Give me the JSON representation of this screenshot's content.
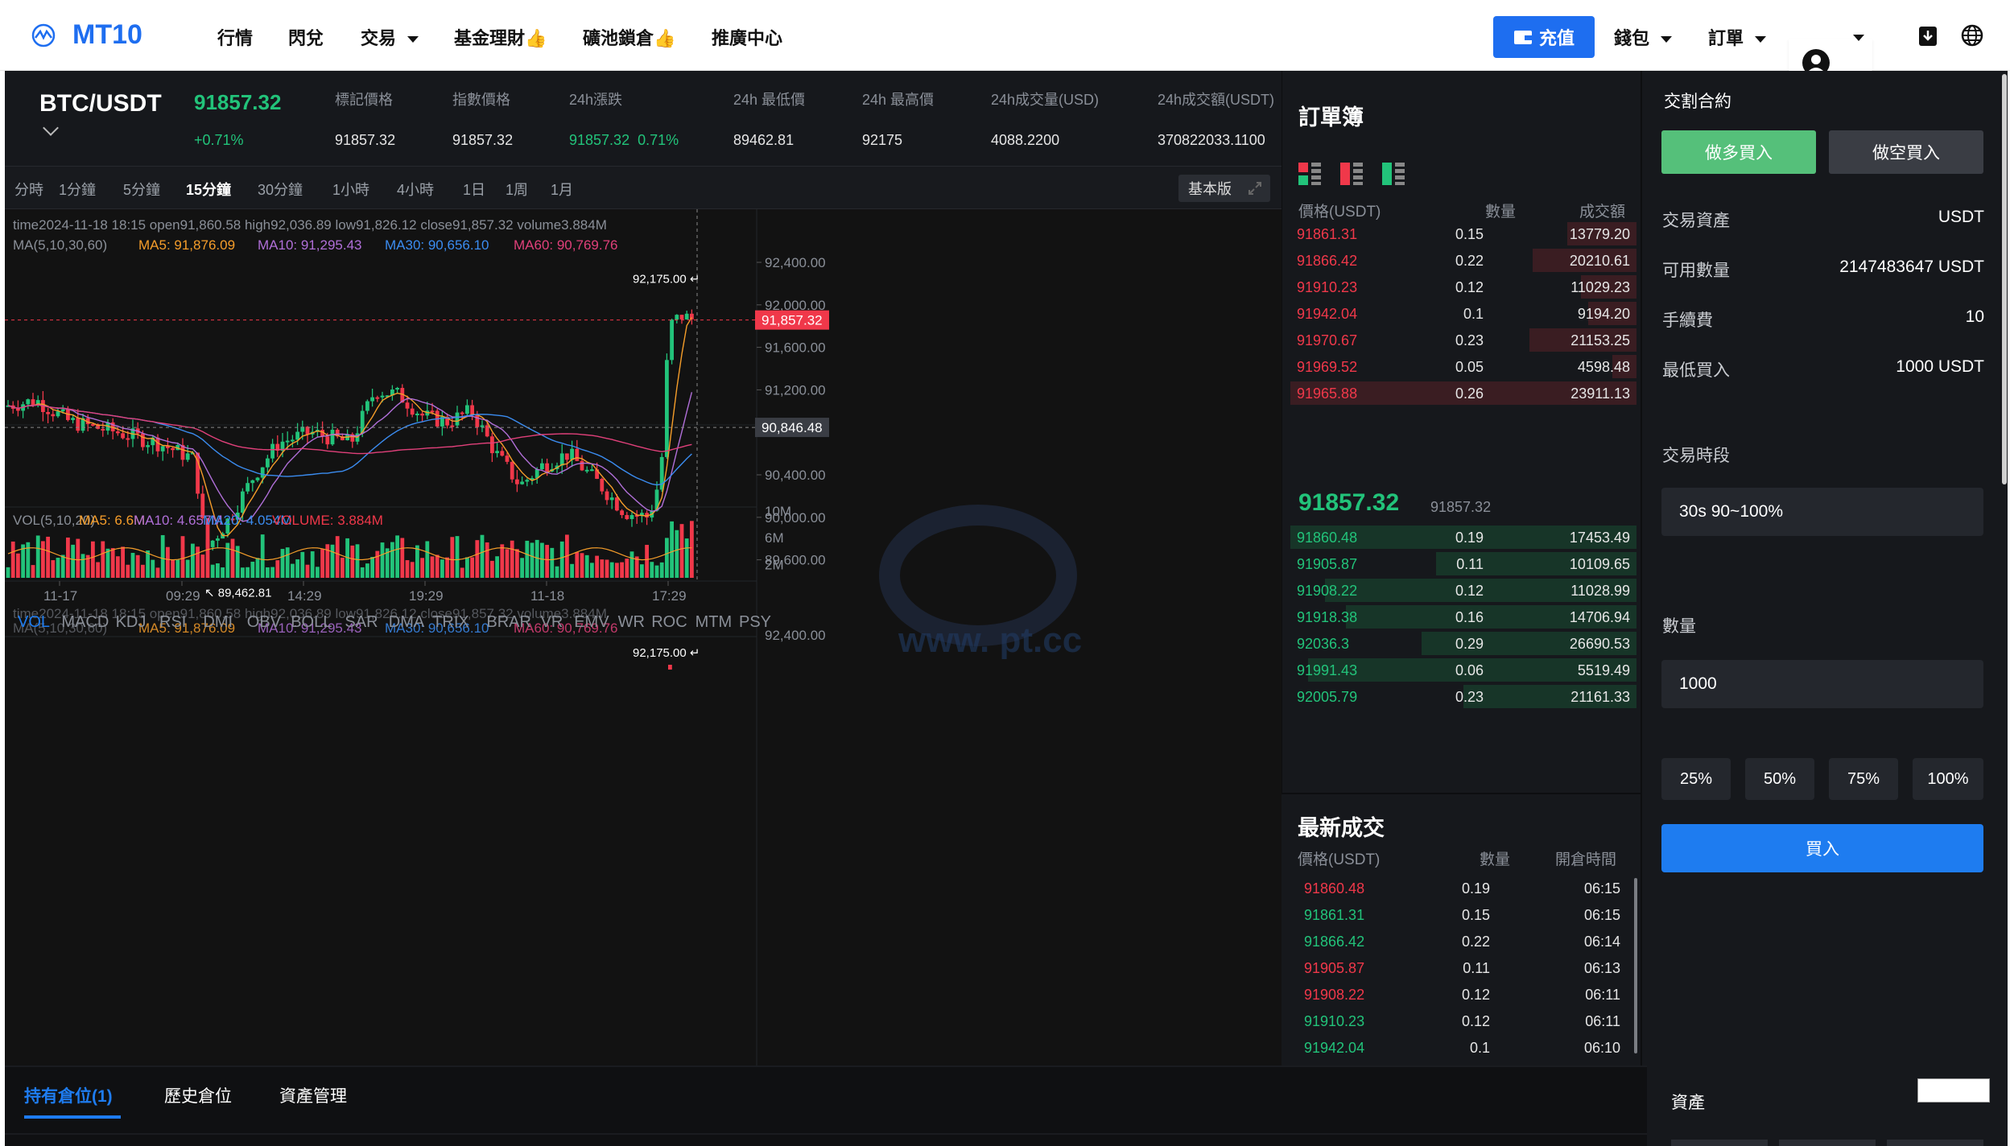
{
  "nav": {
    "brand": "MT10",
    "items": [
      "行情",
      "閃兌",
      "交易",
      "基金理財👍",
      "礦池鎖倉👍",
      "推廣中心"
    ],
    "recharge": "充值",
    "wallet": "錢包",
    "orders": "訂單"
  },
  "ticker": {
    "pair": "BTC/USDT",
    "price": "91857.32",
    "change": "+0.71%",
    "stats": [
      {
        "label": "標記價格",
        "value": "91857.32"
      },
      {
        "label": "指數價格",
        "value": "91857.32"
      },
      {
        "label": "24h漲跌",
        "value": "91857.32  0.71%"
      },
      {
        "label": "24h 最低價",
        "value": "89462.81"
      },
      {
        "label": "24h 最高價",
        "value": "92175"
      },
      {
        "label": "24h成交量(USD)",
        "value": "4088.2200"
      },
      {
        "label": "24h成交額(USDT)",
        "value": "370822033.1100"
      }
    ]
  },
  "chart": {
    "intervals": [
      "分時",
      "1分鐘",
      "5分鐘",
      "15分鐘",
      "30分鐘",
      "1小時",
      "4小時",
      "1日",
      "1周",
      "1月"
    ],
    "active_interval": "15分鐘",
    "mode_button": "基本版",
    "info_line": "time2024-11-18 18:15    open91,860.58    high92,036.89    low91,826.12    close91,857.32    volume3.884M",
    "ma_label": "MA(5,10,30,60)",
    "ma5": "MA5: 91,876.09",
    "ma10": "MA10: 91,295.43",
    "ma30": "MA30: 90,656.10",
    "ma60": "MA60: 90,769.76",
    "price_ticks": [
      "92,400.00",
      "92,000.00",
      "91,600.00",
      "91,200.00",
      "90,400.00",
      "90,000.00",
      "89,600.00"
    ],
    "current_price_tag": "91,857.32",
    "cross_price_tag": "90,846.48",
    "high_mark": "92,175.00",
    "low_mark": "89,462.81",
    "vol_label": "VOL(5,10,20)",
    "vol_ma5": "MA5: 6.6M",
    "vol_ma10": "MA10: 4.657M",
    "vol_ma20": "MA20: 4.054M",
    "vol_volume": "VOLUME: 3.884M",
    "vol_ticks": [
      "10M",
      "6M",
      "2M"
    ],
    "time_ticks": [
      "11-17",
      "09:29",
      "14:29",
      "19:29",
      "11-18",
      "17:29"
    ],
    "indicators": [
      "VOL",
      "MACD",
      "KDJ",
      "RSI",
      "DMI",
      "OBV",
      "BOLL",
      "SAR",
      "DMA",
      "TRIX",
      "BRAR",
      "VR",
      "EMV",
      "WR",
      "ROC",
      "MTM",
      "PSY"
    ],
    "ghost_tick": "92,400.00",
    "watermark": "www.   pt.cc"
  },
  "orderbook": {
    "title": "訂單簿",
    "headers": [
      "價格(USDT)",
      "數量",
      "成交額"
    ],
    "asks": [
      {
        "price": "91861.31",
        "qty": "0.15",
        "total": "13779.20",
        "depth": 0.2
      },
      {
        "price": "91866.42",
        "qty": "0.22",
        "total": "20210.61",
        "depth": 0.3
      },
      {
        "price": "91910.23",
        "qty": "0.12",
        "total": "11029.23",
        "depth": 0.16
      },
      {
        "price": "91942.04",
        "qty": "0.1",
        "total": "9194.20",
        "depth": 0.14
      },
      {
        "price": "91970.67",
        "qty": "0.23",
        "total": "21153.25",
        "depth": 0.31
      },
      {
        "price": "91969.52",
        "qty": "0.05",
        "total": "4598.48",
        "depth": 0.07
      },
      {
        "price": "91965.88",
        "qty": "0.26",
        "total": "23911.13",
        "depth": 1.0
      }
    ],
    "mid_price": "91857.32",
    "mid_sub": "91857.32",
    "bids": [
      {
        "price": "91860.48",
        "qty": "0.19",
        "total": "17453.49",
        "depth": 1.0
      },
      {
        "price": "91905.87",
        "qty": "0.11",
        "total": "10109.65",
        "depth": 0.58
      },
      {
        "price": "91908.22",
        "qty": "0.12",
        "total": "11028.99",
        "depth": 0.9
      },
      {
        "price": "91918.38",
        "qty": "0.16",
        "total": "14706.94",
        "depth": 0.84
      },
      {
        "price": "92036.3",
        "qty": "0.29",
        "total": "26690.53",
        "depth": 0.62
      },
      {
        "price": "91991.43",
        "qty": "0.06",
        "total": "5519.49",
        "depth": 0.95
      },
      {
        "price": "92005.79",
        "qty": "0.23",
        "total": "21161.33",
        "depth": 0.5
      }
    ]
  },
  "trades": {
    "title": "最新成交",
    "headers": [
      "價格(USDT)",
      "數量",
      "開倉時間"
    ],
    "rows": [
      {
        "price": "91860.48",
        "qty": "0.19",
        "time": "06:15",
        "side": "sell"
      },
      {
        "price": "91861.31",
        "qty": "0.15",
        "time": "06:15",
        "side": "buy"
      },
      {
        "price": "91866.42",
        "qty": "0.22",
        "time": "06:14",
        "side": "buy"
      },
      {
        "price": "91905.87",
        "qty": "0.11",
        "time": "06:13",
        "side": "sell"
      },
      {
        "price": "91908.22",
        "qty": "0.12",
        "time": "06:11",
        "side": "sell"
      },
      {
        "price": "91910.23",
        "qty": "0.12",
        "time": "06:11",
        "side": "buy"
      },
      {
        "price": "91942.04",
        "qty": "0.1",
        "time": "06:10",
        "side": "buy"
      }
    ]
  },
  "order_panel": {
    "title": "交割合約",
    "buy_long": "做多買入",
    "sell_short": "做空買入",
    "rows": [
      {
        "label": "交易資產",
        "value": "USDT"
      },
      {
        "label": "可用數量",
        "value": "2147483647 USDT"
      },
      {
        "label": "手續費",
        "value": "10"
      },
      {
        "label": "最低買入",
        "value": "1000 USDT"
      }
    ],
    "period_label": "交易時段",
    "period_value": "30s 90~100%",
    "qty_label": "數量",
    "qty_value": "1000",
    "percents": [
      "25%",
      "50%",
      "75%",
      "100%"
    ],
    "submit": "買入"
  },
  "bottom": {
    "tabs": [
      "持有倉位(1)",
      "歷史倉位",
      "資產管理"
    ],
    "assets": "資產"
  },
  "colors": {
    "up": "#22c37a",
    "down": "#f0384a",
    "accent": "#1e6ef0",
    "buy": "#55c07a"
  }
}
